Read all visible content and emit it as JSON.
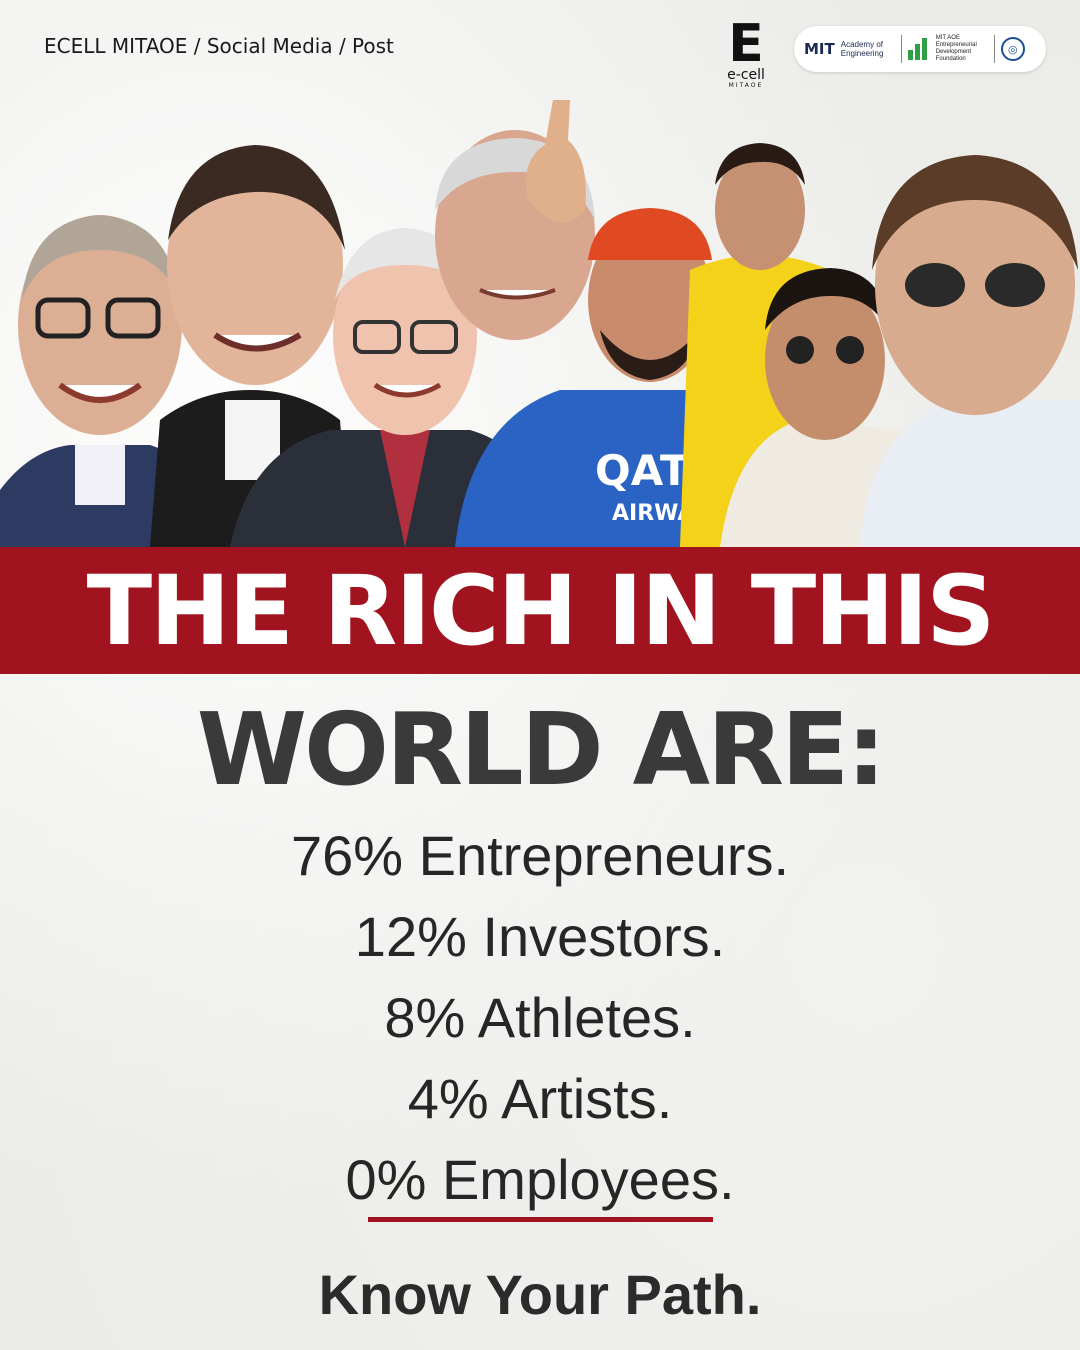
{
  "header": {
    "breadcrumb": "ECELL MITAOE / Social Media / Post",
    "ecell_logo": {
      "mark": "E",
      "name": "e-cell",
      "sub": "MITAOE",
      "icon": "ecell-logo"
    },
    "partner_badge": {
      "mit": "MIT",
      "academy": "Academy of Engineering",
      "edf": "MIT AOE Entrepreneurial Development Foundation",
      "iic": "IIC MITAOE"
    }
  },
  "collage": {
    "icon": "celebrity-photo-collage",
    "people_count": 8
  },
  "banner": {
    "text": "THE RICH IN THIS"
  },
  "headline2": "WORLD ARE:",
  "stats": [
    {
      "text": "76% Entrepreneurs."
    },
    {
      "text": "12% Investors."
    },
    {
      "text": "8% Athletes."
    },
    {
      "text": "4% Artists."
    },
    {
      "text": "0% Employees."
    }
  ],
  "tagline": "Know Your Path.",
  "colors": {
    "accent": "#a1131f",
    "text_dark": "#3a3a3a",
    "background": "#f2f2f0"
  }
}
